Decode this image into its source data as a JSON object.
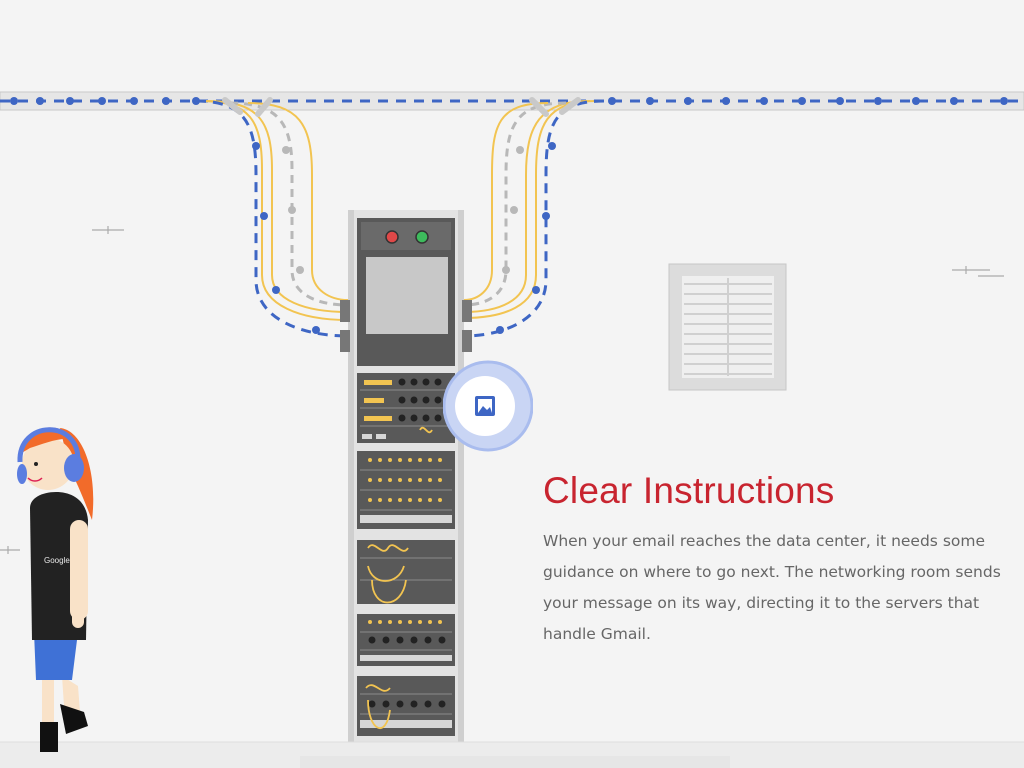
{
  "section": {
    "title": "Clear Instructions",
    "body": "When your email reaches the data center, it needs some guidance on where to go next. The networking room sends your message on its way, directing it to the servers that handle Gmail."
  },
  "character": {
    "shirt_label": "Google"
  },
  "colors": {
    "title": "#c8242f",
    "cable_blue": "#3e66c4",
    "cable_yellow": "#f2c451",
    "cable_gray": "#b8b8b8",
    "rack": "#595959",
    "hair": "#f26b2a",
    "headphones": "#5b7de0",
    "shorts": "#3f71d6",
    "hotspot_ring": "#7d9be8"
  },
  "icons": {
    "hotspot": "image-icon"
  }
}
